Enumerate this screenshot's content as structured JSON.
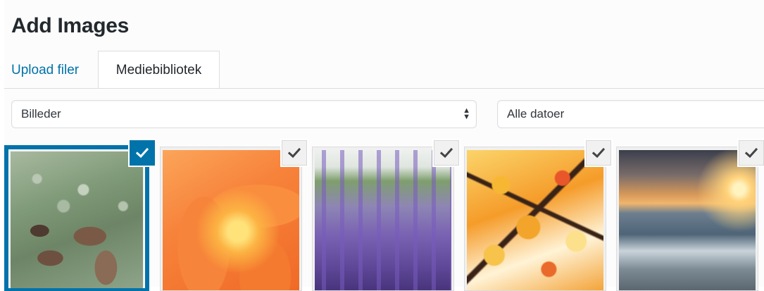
{
  "header": {
    "title": "Add Images"
  },
  "tabs": [
    {
      "label": "Upload filer",
      "active": false
    },
    {
      "label": "Mediebibliotek",
      "active": true
    }
  ],
  "filters": {
    "type": {
      "selected": "Billeder"
    },
    "date": {
      "selected": "Alle datoer"
    }
  },
  "colors": {
    "accent": "#0073aa",
    "link": "#0073aa",
    "title": "#23282d"
  },
  "attachments": [
    {
      "subject": "frosty-leaves",
      "selected": true,
      "icon": "checkmark-icon"
    },
    {
      "subject": "orange-lily",
      "selected": false,
      "icon": "checkmark-icon"
    },
    {
      "subject": "lavender-field",
      "selected": false,
      "icon": "checkmark-icon"
    },
    {
      "subject": "autumn-maple",
      "selected": false,
      "icon": "checkmark-icon"
    },
    {
      "subject": "sunset-sea",
      "selected": false,
      "icon": "checkmark-icon"
    }
  ]
}
